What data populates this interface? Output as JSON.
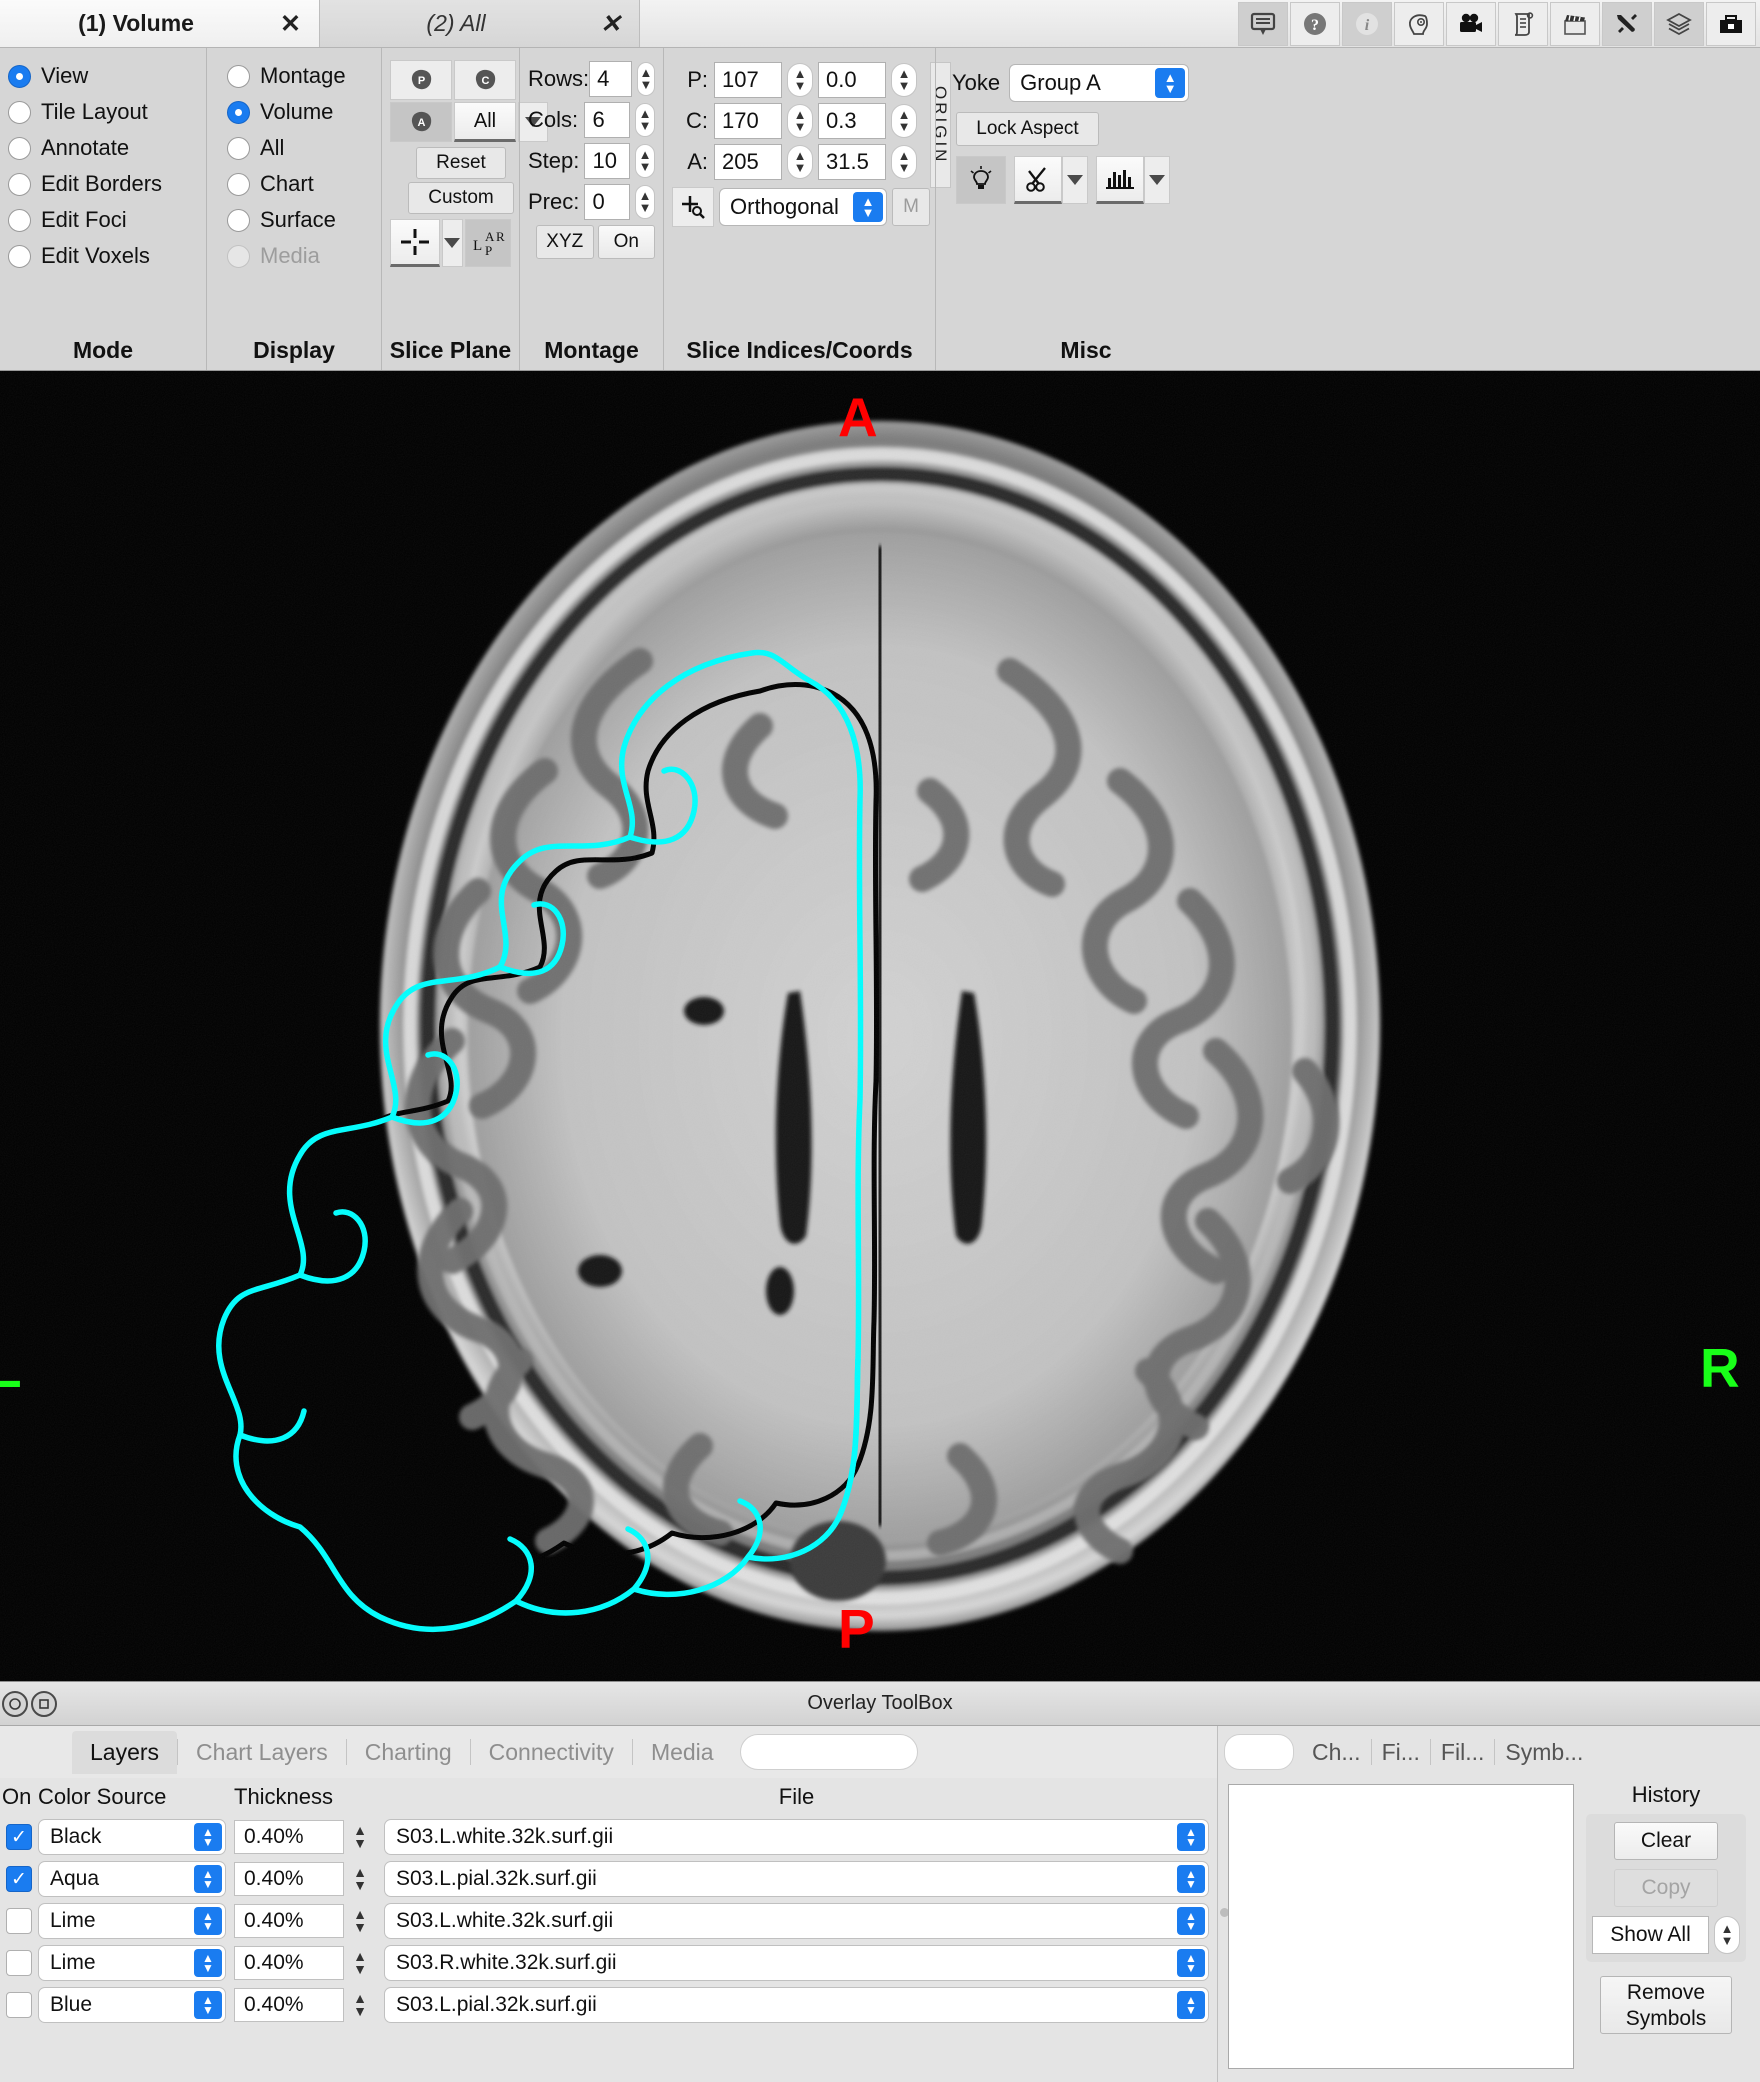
{
  "tabs": [
    {
      "label": "(1) Volume",
      "close": "✕",
      "active": true
    },
    {
      "label": "(2) All",
      "close": "✕",
      "active": false
    }
  ],
  "toolbar_icons": [
    {
      "name": "information-balloon-icon",
      "pressed": true
    },
    {
      "name": "help-question-icon",
      "pressed": false
    },
    {
      "name": "info-italic-icon",
      "pressed": true
    },
    {
      "name": "brain-identify-icon",
      "pressed": false
    },
    {
      "name": "movie-camera-icon",
      "pressed": false
    },
    {
      "name": "scene-scroll-icon",
      "pressed": false
    },
    {
      "name": "clapperboard-icon",
      "pressed": false
    },
    {
      "name": "tools-preferences-icon",
      "pressed": true
    },
    {
      "name": "layers-overlay-icon",
      "pressed": true
    },
    {
      "name": "toolbox-case-icon",
      "pressed": false
    }
  ],
  "ribbon": {
    "mode": {
      "title": "Mode",
      "options": [
        {
          "label": "View",
          "selected": true,
          "disabled": false
        },
        {
          "label": "Tile Layout",
          "selected": false,
          "disabled": false
        },
        {
          "label": "Annotate",
          "selected": false,
          "disabled": false
        },
        {
          "label": "Edit Borders",
          "selected": false,
          "disabled": false
        },
        {
          "label": "Edit Foci",
          "selected": false,
          "disabled": false
        },
        {
          "label": "Edit Voxels",
          "selected": false,
          "disabled": false
        }
      ]
    },
    "display": {
      "title": "Display",
      "options": [
        {
          "label": "Montage",
          "selected": false,
          "disabled": false
        },
        {
          "label": "Volume",
          "selected": true,
          "disabled": false
        },
        {
          "label": "All",
          "selected": false,
          "disabled": false
        },
        {
          "label": "Chart",
          "selected": false,
          "disabled": false
        },
        {
          "label": "Surface",
          "selected": false,
          "disabled": false
        },
        {
          "label": "Media",
          "selected": false,
          "disabled": true
        }
      ]
    },
    "slice_plane": {
      "title": "Slice Plane",
      "parasagittal_label": "P",
      "coronal_label": "C",
      "axial_label": "A",
      "all_label": "All",
      "reset_label": "Reset",
      "custom_label": "Custom",
      "orient_label_l": "L",
      "orient_label_a": "A",
      "orient_label_p": "P",
      "orient_label_r": "R",
      "axial_selected": true,
      "all_selected": true
    },
    "montage": {
      "title": "Montage",
      "rows_label": "Rows:",
      "rows_value": "4",
      "cols_label": "Cols:",
      "cols_value": "6",
      "step_label": "Step:",
      "step_value": "10",
      "prec_label": "Prec:",
      "prec_value": "0",
      "xyz_label": "XYZ",
      "on_label": "On"
    },
    "slice_indices": {
      "title": "Slice Indices/Coords",
      "rows": [
        {
          "label": "P:",
          "index": "107",
          "coord": "0.0"
        },
        {
          "label": "C:",
          "index": "170",
          "coord": "0.3"
        },
        {
          "label": "A:",
          "index": "205",
          "coord": "31.5"
        }
      ],
      "origin_label": "ORIGIN",
      "mode_value": "Orthogonal",
      "m_label": "M",
      "crosshair_icon": "identify-crosshair-icon"
    },
    "misc": {
      "title": "Misc",
      "yoke_label": "Yoke",
      "yoke_value": "Group A",
      "lock_aspect_label": "Lock Aspect",
      "lighting_icon": "light-bulb-icon",
      "clipping_icon": "scissors-icon",
      "histogram_icon": "histogram-icon"
    }
  },
  "viewport": {
    "orientation_anterior": "A",
    "orientation_posterior": "P",
    "orientation_left": "L",
    "orientation_right": "R",
    "anterior_color": "#ff0000",
    "posterior_color": "#ff0000",
    "left_color": "#19ff19",
    "right_color": "#19ff19",
    "background_color": "#000000",
    "white_surface_outline_color": "#000000",
    "pial_surface_outline_color": "#00ffff"
  },
  "overlay_toolbox": {
    "window_title": "Overlay ToolBox",
    "tabs": [
      {
        "label": "Layers",
        "selected": true
      },
      {
        "label": "Chart Layers",
        "selected": false
      },
      {
        "label": "Charting",
        "selected": false
      },
      {
        "label": "Connectivity",
        "selected": false
      },
      {
        "label": "Media",
        "selected": false
      }
    ],
    "search_value": "",
    "columns": {
      "on": "On",
      "color_source": "Color Source",
      "thickness": "Thickness",
      "file": "File"
    },
    "layers": [
      {
        "on": true,
        "color_source": "Black",
        "thickness": "0.40%",
        "file": "S03.L.white.32k.surf.gii"
      },
      {
        "on": true,
        "color_source": "Aqua",
        "thickness": "0.40%",
        "file": "S03.L.pial.32k.surf.gii"
      },
      {
        "on": false,
        "color_source": "Lime",
        "thickness": "0.40%",
        "file": "S03.L.white.32k.surf.gii"
      },
      {
        "on": false,
        "color_source": "Lime",
        "thickness": "0.40%",
        "file": "S03.R.white.32k.surf.gii"
      },
      {
        "on": false,
        "color_source": "Blue",
        "thickness": "0.40%",
        "file": "S03.L.pial.32k.surf.gii"
      }
    ]
  },
  "right_panel": {
    "search_value": "",
    "tabs": [
      {
        "label": "Ch..."
      },
      {
        "label": "Fi..."
      },
      {
        "label": "Fil..."
      },
      {
        "label": "Symb..."
      }
    ],
    "history_label": "History",
    "clear_label": "Clear",
    "copy_label": "Copy",
    "show_all_label": "Show All",
    "remove_symbols_line1": "Remove",
    "remove_symbols_line2": "Symbols",
    "log_text": ""
  }
}
